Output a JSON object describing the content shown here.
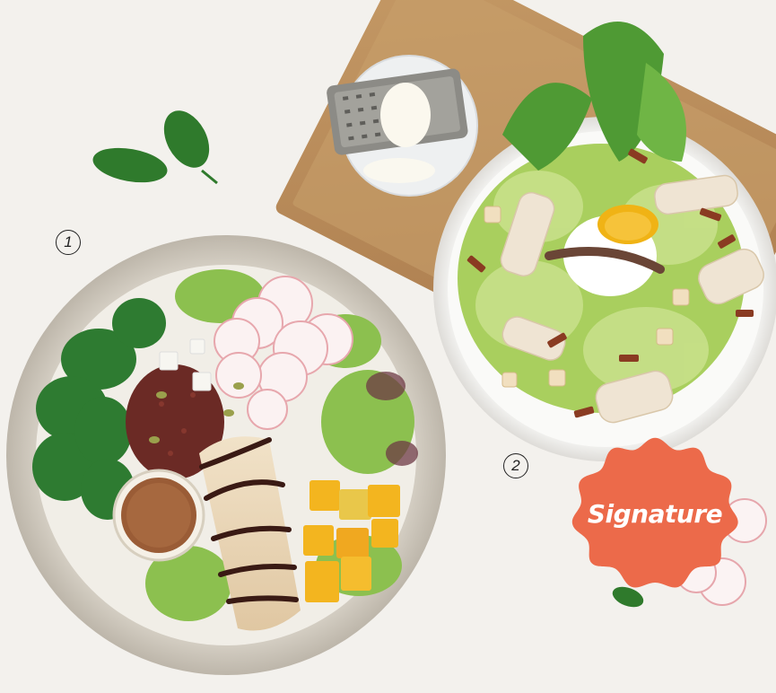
{
  "labels": {
    "item_1": "1",
    "item_2": "2"
  },
  "badge": {
    "text": "Signature",
    "color": "#ec6a4a"
  },
  "colors": {
    "background": "#f3f1ed",
    "tray": "#b98a55",
    "bowl_left": "#d9d4ca",
    "bowl_right": "#ffffff"
  }
}
